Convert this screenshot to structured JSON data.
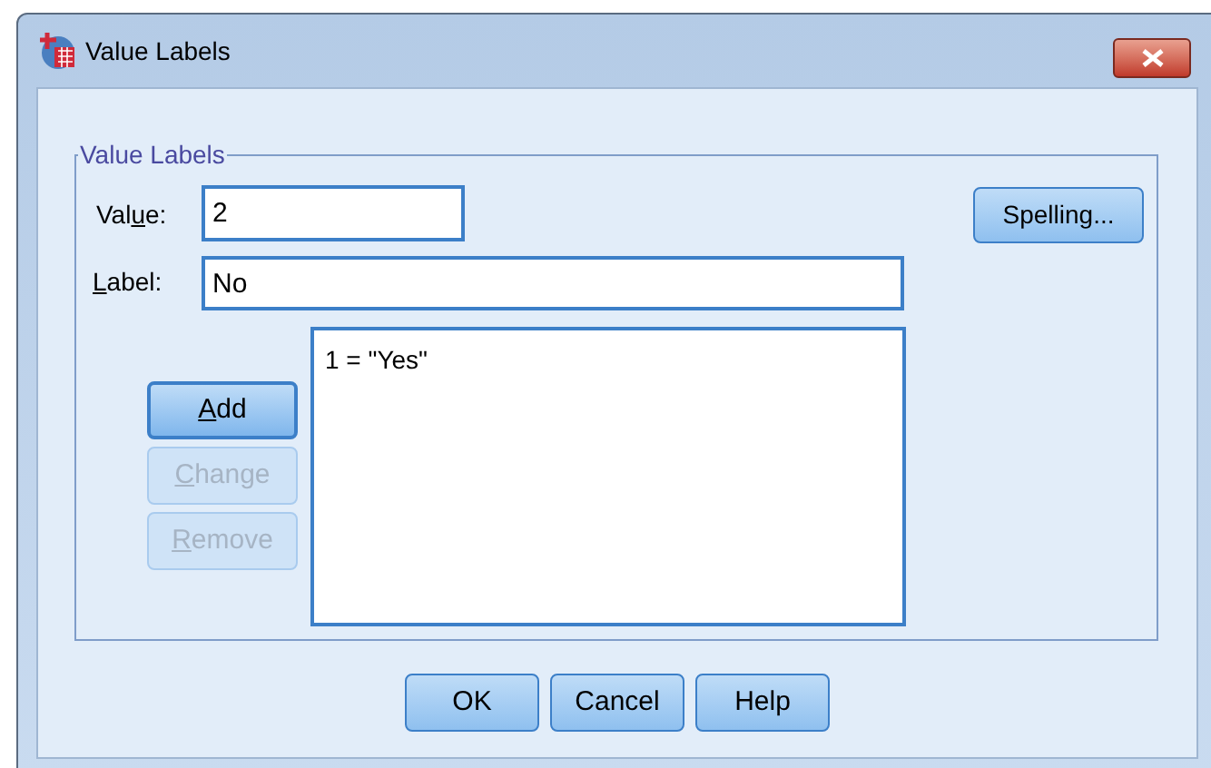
{
  "window": {
    "title": "Value Labels"
  },
  "group": {
    "title": "Value Labels"
  },
  "value_field": {
    "label_parts": {
      "pre": "Val",
      "key": "u",
      "post": "e:"
    },
    "value": "2"
  },
  "label_field": {
    "label_parts": {
      "key": "L",
      "post": "abel:"
    },
    "value": "No"
  },
  "spelling_button": {
    "label": "Spelling..."
  },
  "side_buttons": [
    {
      "label_parts": {
        "key": "A",
        "post": "dd"
      },
      "disabled": false
    },
    {
      "label_parts": {
        "key": "C",
        "post": "hange"
      },
      "disabled": true
    },
    {
      "label_parts": {
        "key": "R",
        "post": "emove"
      },
      "disabled": true
    }
  ],
  "list": {
    "items": [
      "1 = \"Yes\""
    ]
  },
  "buttons": [
    "OK",
    "Cancel",
    "Help"
  ]
}
